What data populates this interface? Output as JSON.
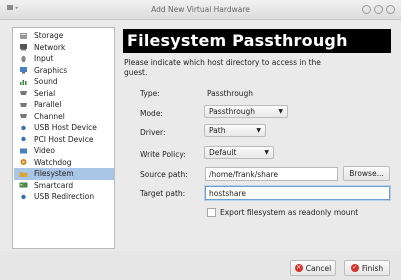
{
  "window": {
    "title": "Add New Virtual Hardware"
  },
  "sidebar": {
    "items": [
      {
        "label": "Storage",
        "icon": "storage-icon"
      },
      {
        "label": "Network",
        "icon": "network-icon"
      },
      {
        "label": "Input",
        "icon": "input-icon"
      },
      {
        "label": "Graphics",
        "icon": "graphics-icon"
      },
      {
        "label": "Sound",
        "icon": "sound-icon"
      },
      {
        "label": "Serial",
        "icon": "serial-icon"
      },
      {
        "label": "Parallel",
        "icon": "parallel-icon"
      },
      {
        "label": "Channel",
        "icon": "channel-icon"
      },
      {
        "label": "USB Host Device",
        "icon": "usb-icon"
      },
      {
        "label": "PCI Host Device",
        "icon": "pci-icon"
      },
      {
        "label": "Video",
        "icon": "video-icon"
      },
      {
        "label": "Watchdog",
        "icon": "watchdog-icon"
      },
      {
        "label": "Filesystem",
        "icon": "filesystem-icon",
        "selected": true
      },
      {
        "label": "Smartcard",
        "icon": "smartcard-icon"
      },
      {
        "label": "USB Redirection",
        "icon": "usb-redirection-icon"
      }
    ]
  },
  "main": {
    "title": "Filesystem Passthrough",
    "description": "Please indicate which host directory to access in the guest.",
    "type": {
      "label": "Type:",
      "value": "Passthrough"
    },
    "mode": {
      "label": "Mode:",
      "value": "Passthrough"
    },
    "driver": {
      "label": "Driver:",
      "value": "Path"
    },
    "write_policy": {
      "label": "Write Policy:",
      "value": "Default"
    },
    "source_path": {
      "label": "Source path:",
      "value": "/home/frank/share",
      "browse": "Browse..."
    },
    "target_path": {
      "label": "Target path:",
      "value": "hostshare"
    },
    "readonly": {
      "label": "Export filesystem as readonly mount",
      "checked": false
    }
  },
  "footer": {
    "cancel": "Cancel",
    "finish": "Finish"
  },
  "colors": {
    "selection": "#a9c6e6",
    "banner": "#000000",
    "button_icon": "#d5322b"
  }
}
